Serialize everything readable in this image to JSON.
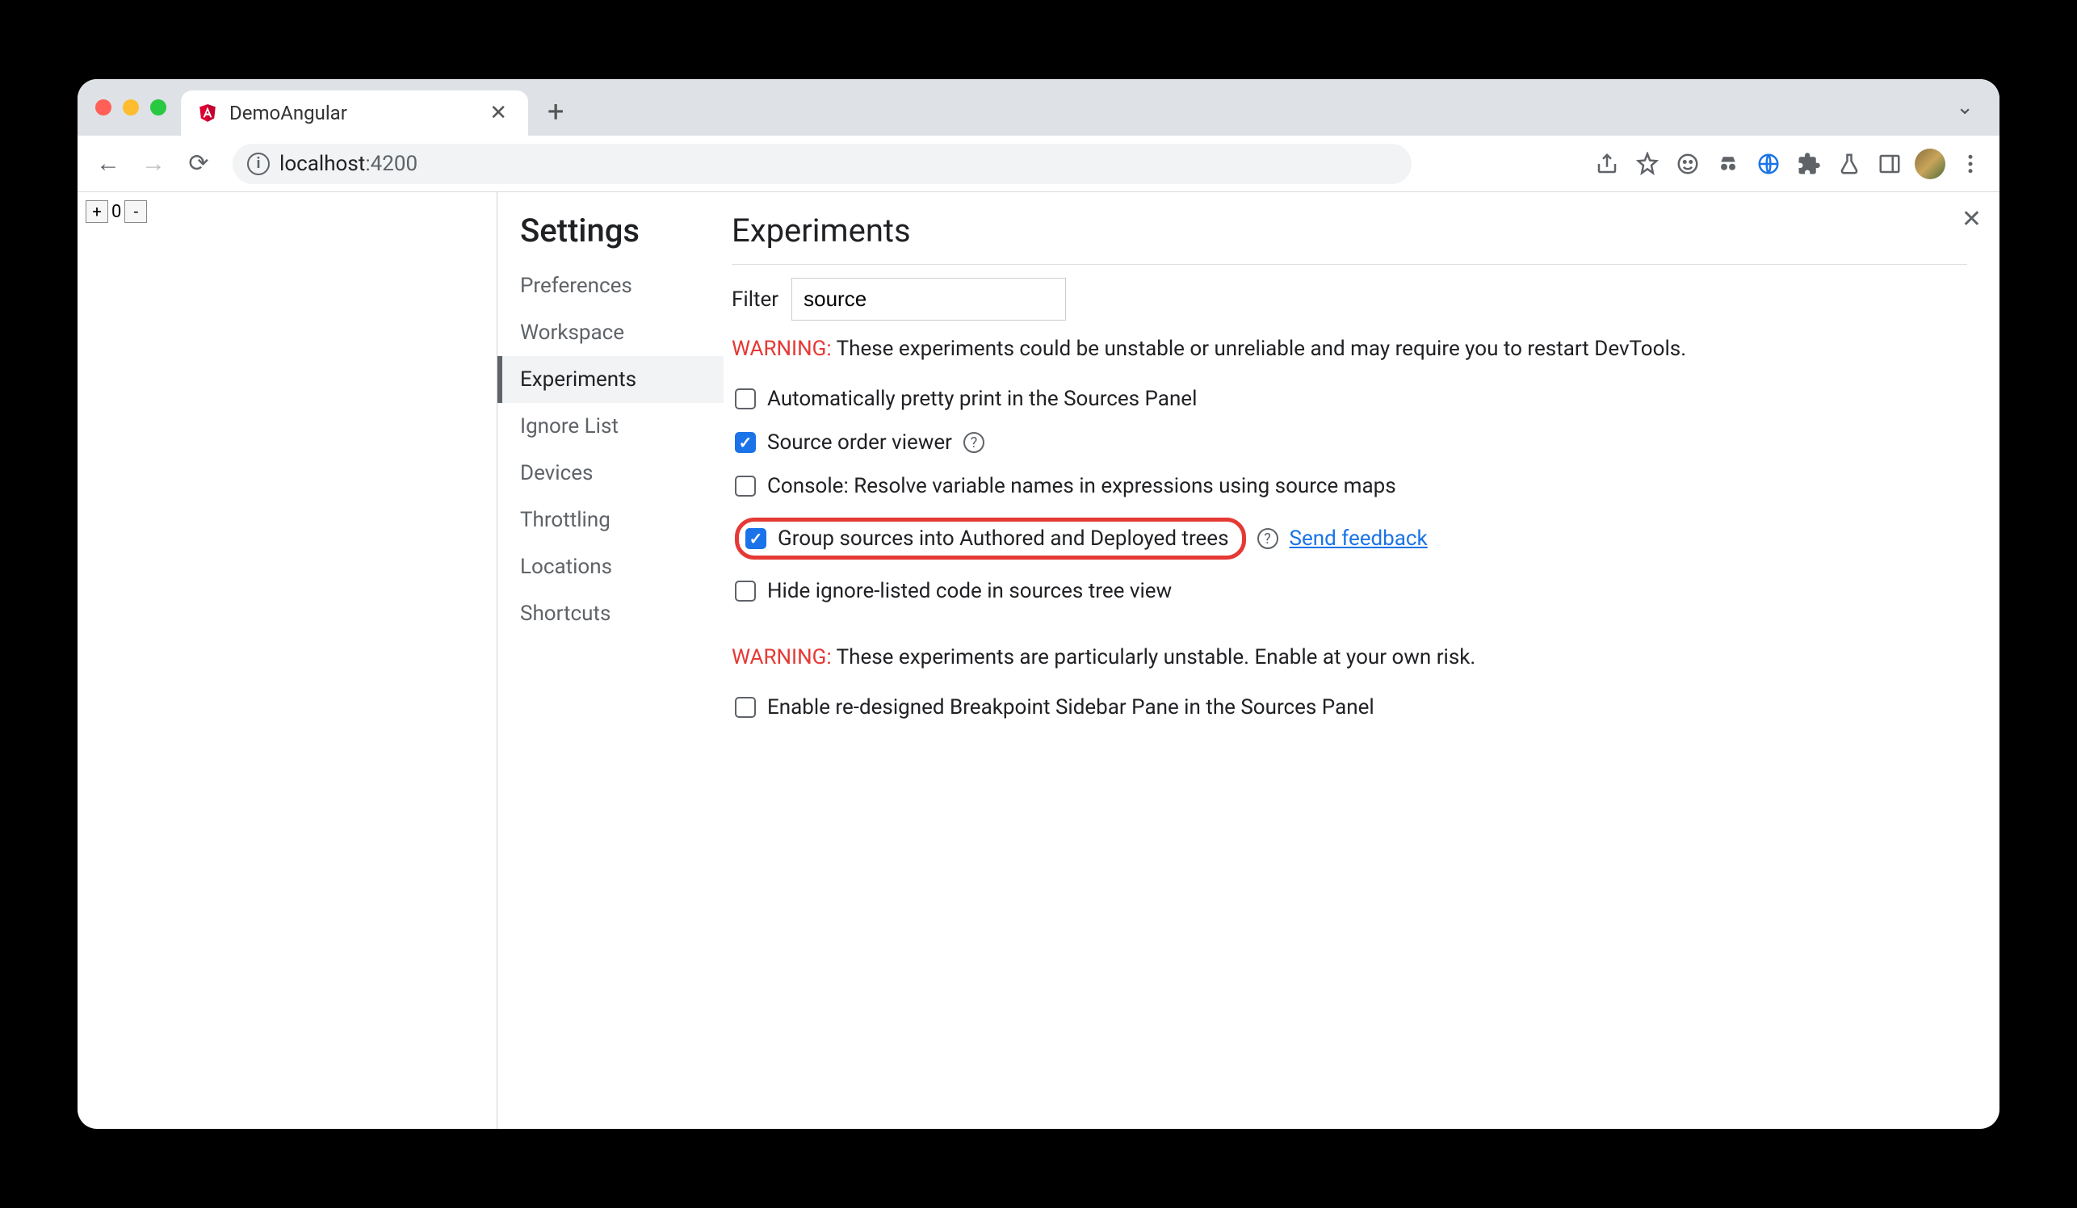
{
  "tab": {
    "title": "DemoAngular"
  },
  "url": {
    "host": "localhost",
    "port": ":4200"
  },
  "page": {
    "counter_value": "0"
  },
  "settings": {
    "heading": "Settings",
    "nav": [
      "Preferences",
      "Workspace",
      "Experiments",
      "Ignore List",
      "Devices",
      "Throttling",
      "Locations",
      "Shortcuts"
    ],
    "active_nav_index": 2
  },
  "experiments": {
    "heading": "Experiments",
    "filter_label": "Filter",
    "filter_value": "source",
    "warning1_prefix": "WARNING:",
    "warning1_text": " These experiments could be unstable or unreliable and may require you to restart DevTools.",
    "items": [
      {
        "label": "Automatically pretty print in the Sources Panel",
        "checked": false,
        "help": false
      },
      {
        "label": "Source order viewer",
        "checked": true,
        "help": true
      },
      {
        "label": "Console: Resolve variable names in expressions using source maps",
        "checked": false,
        "help": false
      },
      {
        "label": "Group sources into Authored and Deployed trees",
        "checked": true,
        "help": true,
        "feedback": true,
        "highlighted": true
      },
      {
        "label": "Hide ignore-listed code in sources tree view",
        "checked": false,
        "help": false
      }
    ],
    "feedback_label": "Send feedback",
    "warning2_prefix": "WARNING:",
    "warning2_text": " These experiments are particularly unstable. Enable at your own risk.",
    "items2": [
      {
        "label": "Enable re-designed Breakpoint Sidebar Pane in the Sources Panel",
        "checked": false
      }
    ]
  }
}
